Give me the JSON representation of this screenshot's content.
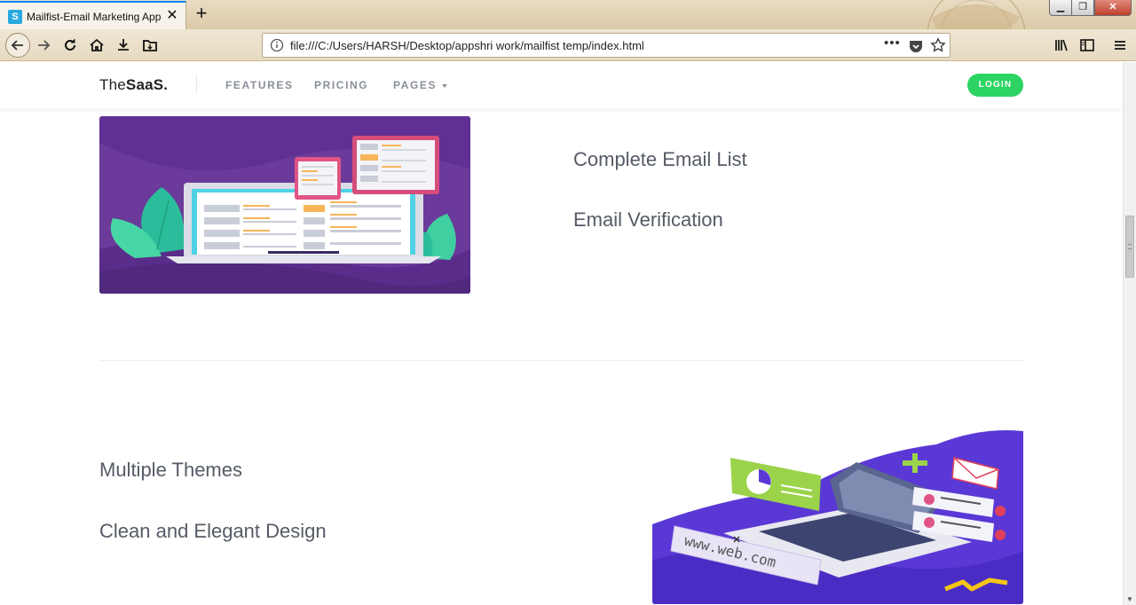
{
  "browser": {
    "tab_title": "Mailfist-Email Marketing App",
    "tab_favicon_letter": "S",
    "url": "file:///C:/Users/HARSH/Desktop/appshri work/mailfist temp/index.html",
    "url_more": "•••"
  },
  "navbar": {
    "brand_part1": "The",
    "brand_part2": "SaaS.",
    "links": [
      {
        "label": "FEATURES"
      },
      {
        "label": "PRICING"
      },
      {
        "label": "PAGES"
      }
    ],
    "login_label": "LOGIN"
  },
  "sections": [
    {
      "features": [
        "Complete Email List",
        "Email Verification"
      ]
    },
    {
      "features": [
        "Multiple Themes",
        "Clean and Elegant Design"
      ],
      "image_text": "www.web.com"
    }
  ],
  "colors": {
    "accent_green": "#2bd463",
    "purple_bg": "#6b3a9a",
    "blue_purple_bg": "#5a38d6"
  }
}
